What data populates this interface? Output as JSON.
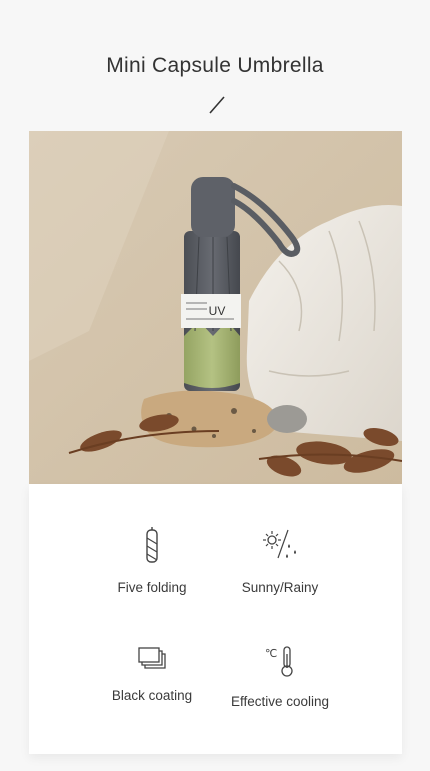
{
  "header": {
    "title": "Mini Capsule Umbrella"
  },
  "features": [
    {
      "label": "Five folding",
      "icon": "folded-umbrella-icon"
    },
    {
      "label": "Sunny/Rainy",
      "icon": "sun-rain-icon"
    },
    {
      "label": "Black coating",
      "icon": "layers-icon"
    },
    {
      "label": "Effective cooling",
      "icon": "thermometer-icon"
    }
  ],
  "product": {
    "tag_text": "UV"
  },
  "colors": {
    "background": "#f7f7f7",
    "umbrella_gray": "#5b5e64",
    "umbrella_green": "#a9b976",
    "photo_background": "#d9ccb7"
  }
}
